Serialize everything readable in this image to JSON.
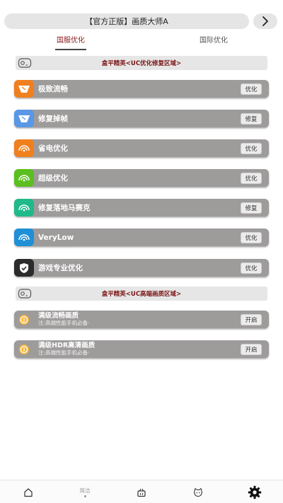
{
  "header": {
    "title": "【官方正版】画质大师A",
    "next_icon": "chevron-right-icon"
  },
  "tabs": [
    {
      "label": "国服优化",
      "active": true
    },
    {
      "label": "国际优化",
      "active": false
    }
  ],
  "sections": [
    {
      "title": "盒平精英<UC优化修复区域>",
      "icon": "gamepad-icon"
    },
    {
      "title": "盒平精英<UC高端画质区域>",
      "icon": "gamepad-icon"
    }
  ],
  "options": [
    {
      "label": "极致流畅",
      "action": "优化",
      "icon": "speed-icon",
      "color": "#f07f1e"
    },
    {
      "label": "修复掉帧",
      "action": "修复",
      "icon": "speed-icon",
      "color": "#5a97e6"
    },
    {
      "label": "省电优化",
      "action": "优化",
      "icon": "wifi-gauge-icon",
      "color": "#f07f1e"
    },
    {
      "label": "超级优化",
      "action": "优化",
      "icon": "wifi-gauge-icon",
      "color": "#5bbf1f"
    },
    {
      "label": "修复落地马赛克",
      "action": "修复",
      "icon": "wifi-gauge-icon",
      "color": "#1fb98a"
    },
    {
      "label": "VeryLow",
      "action": "优化",
      "icon": "wifi-gauge-icon",
      "color": "#1f8fd6"
    },
    {
      "label": "游戏专业优化",
      "action": "优化",
      "icon": "shield-check-icon",
      "color": "#2b2b2b"
    }
  ],
  "features": [
    {
      "title": "满级流畅画质",
      "subtitle": "注:高端性能手机必备·",
      "action": "开启",
      "icon": "coin-icon",
      "color": "#f4b63c"
    },
    {
      "title": "满级HDR高清画质",
      "subtitle": "注:高端性能手机必备·",
      "action": "开启",
      "icon": "coin-icon",
      "color": "#f4b63c"
    }
  ],
  "bottom_nav": [
    {
      "label": "",
      "icon": "home-icon"
    },
    {
      "label": "简洁",
      "icon": "",
      "has_dot": true
    },
    {
      "label": "",
      "icon": "basket-icon"
    },
    {
      "label": "",
      "icon": "cat-face-icon"
    },
    {
      "label": "",
      "icon": "gear-icon"
    }
  ]
}
